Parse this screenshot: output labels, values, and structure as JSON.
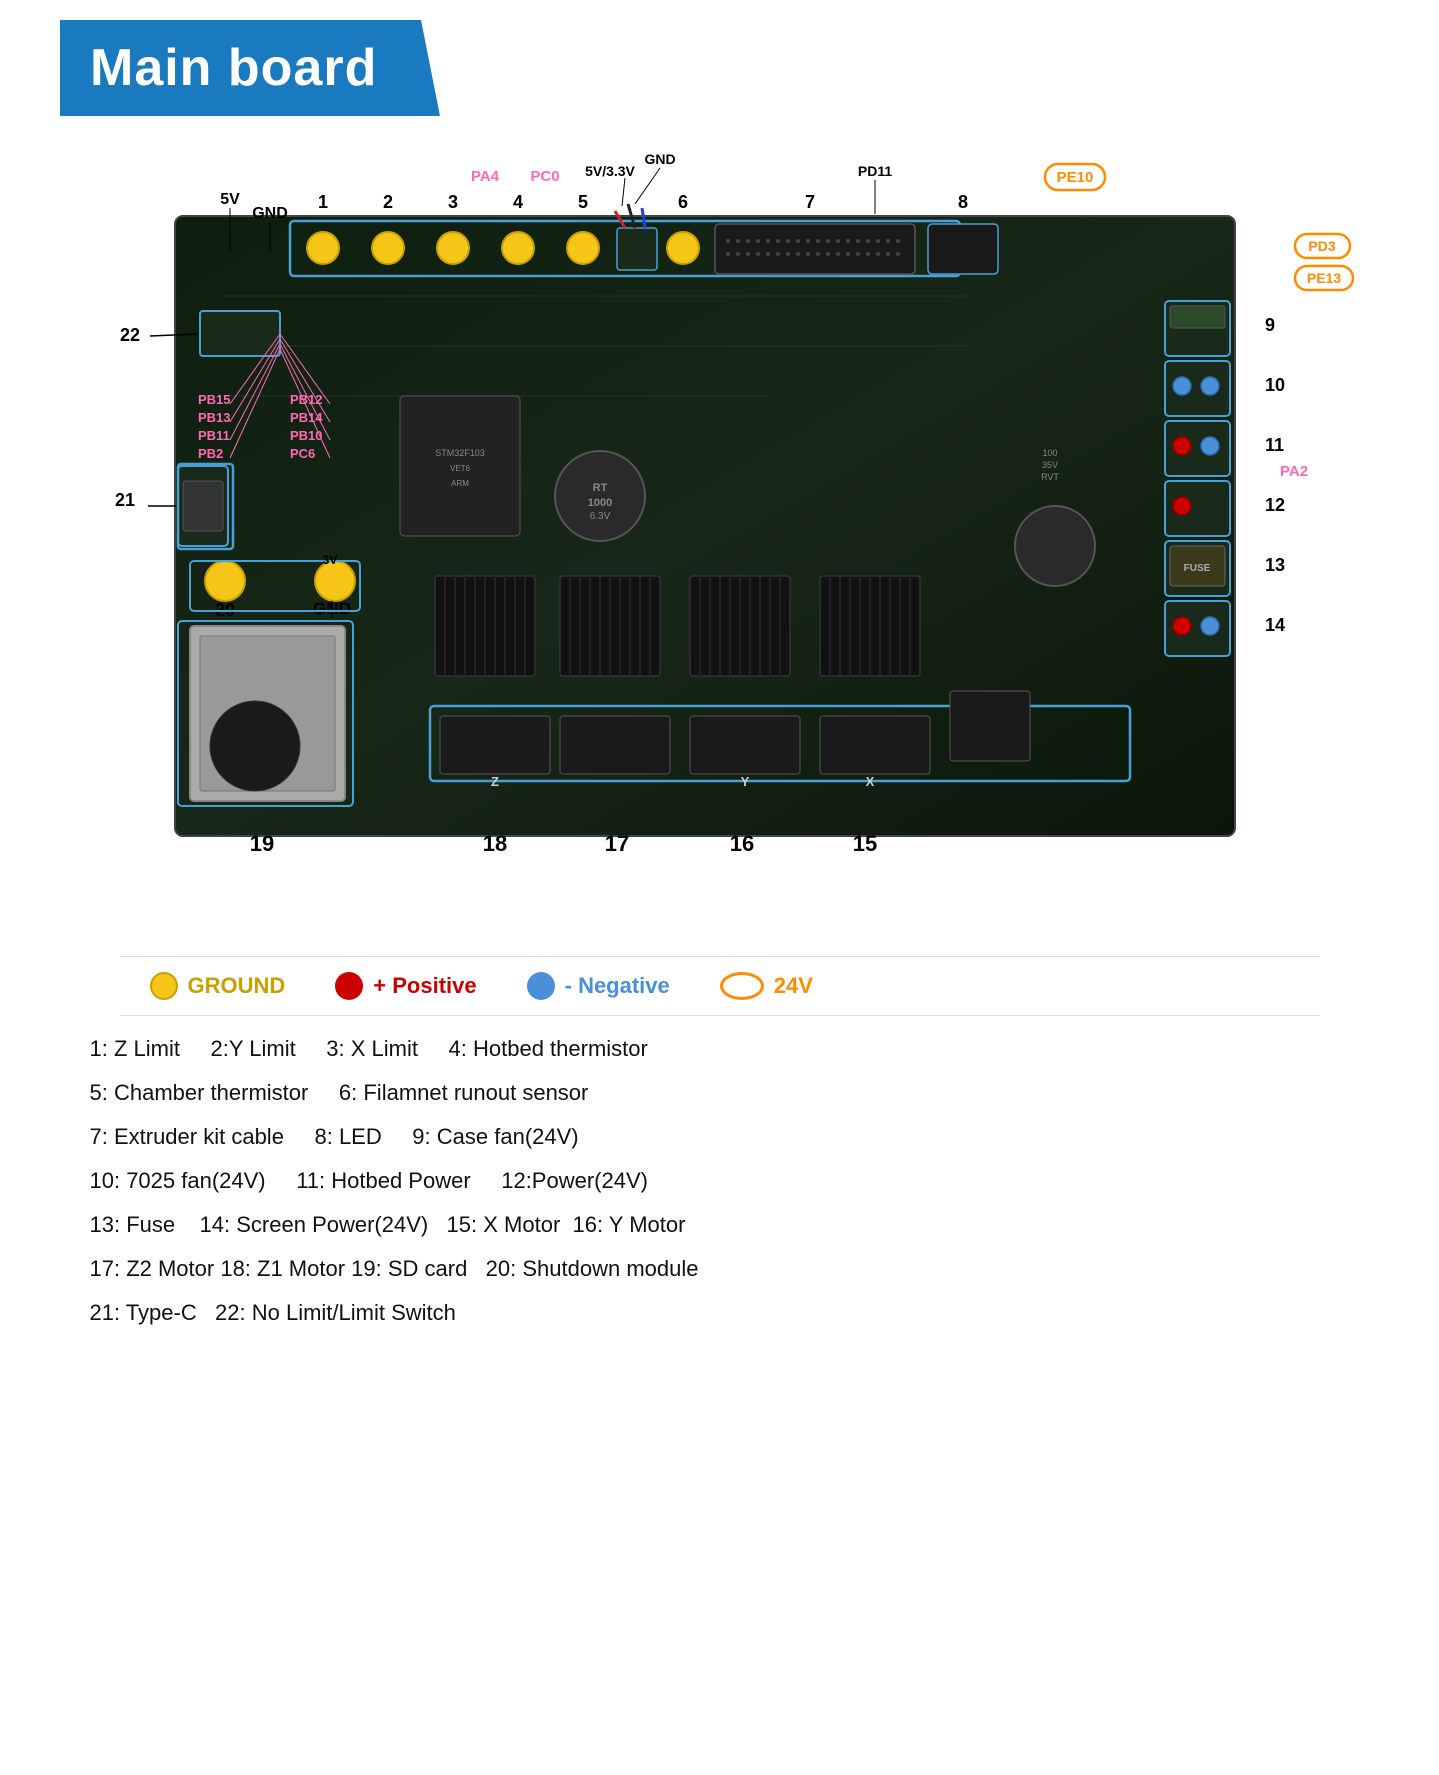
{
  "header": {
    "title": "Main board"
  },
  "legend": {
    "items": [
      {
        "id": "ground",
        "symbol": "circle-yellow",
        "label": "GROUND"
      },
      {
        "id": "positive",
        "symbol": "circle-red",
        "label": "+ Positive"
      },
      {
        "id": "negative",
        "symbol": "circle-blue",
        "label": "- Negative"
      },
      {
        "id": "24v",
        "symbol": "oval-orange",
        "label": "24V"
      }
    ]
  },
  "labels": {
    "top_voltage": [
      "5V",
      "GND"
    ],
    "pin_labels_pink": [
      "PA4",
      "PC0"
    ],
    "pin_labels_middle": [
      "5V/3.3V",
      "GND"
    ],
    "pin_labels_right": [
      "PD11"
    ],
    "pin_labels_orange": [
      "PE10",
      "PD3",
      "PE13"
    ],
    "side_labels_pink_left": [
      "PB15",
      "PB13",
      "PB11",
      "PB2",
      "PB12",
      "PB14",
      "PB10",
      "PC6"
    ],
    "right_pink": [
      "PA2"
    ],
    "bottom_label": "GND",
    "numbered_connectors": [
      "1",
      "2",
      "3",
      "4",
      "5",
      "6",
      "7",
      "8",
      "9",
      "10",
      "11",
      "12",
      "13",
      "14",
      "15",
      "16",
      "17",
      "18",
      "19",
      "20",
      "21",
      "22"
    ]
  },
  "descriptions": [
    {
      "line": "1: Z Limit     2:Y Limit     3: X Limit     4: Hotbed thermistor"
    },
    {
      "line": "5: Chamber thermistor     6: Filamnet runout sensor"
    },
    {
      "line": "7: Extruder kit cable     8: LED     9: Case fan(24V)"
    },
    {
      "line": "10: 7025 fan(24V)     11: Hotbed Power     12:Power(24V)"
    },
    {
      "line": "13: Fuse    14: Screen Power(24V)   15: X Motor  16: Y Motor"
    },
    {
      "line": "17: Z2 Motor 18: Z1 Motor 19: SD card   20: Shutdown module"
    },
    {
      "line": "21: Type-C   22: No Limit/Limit Switch"
    }
  ]
}
